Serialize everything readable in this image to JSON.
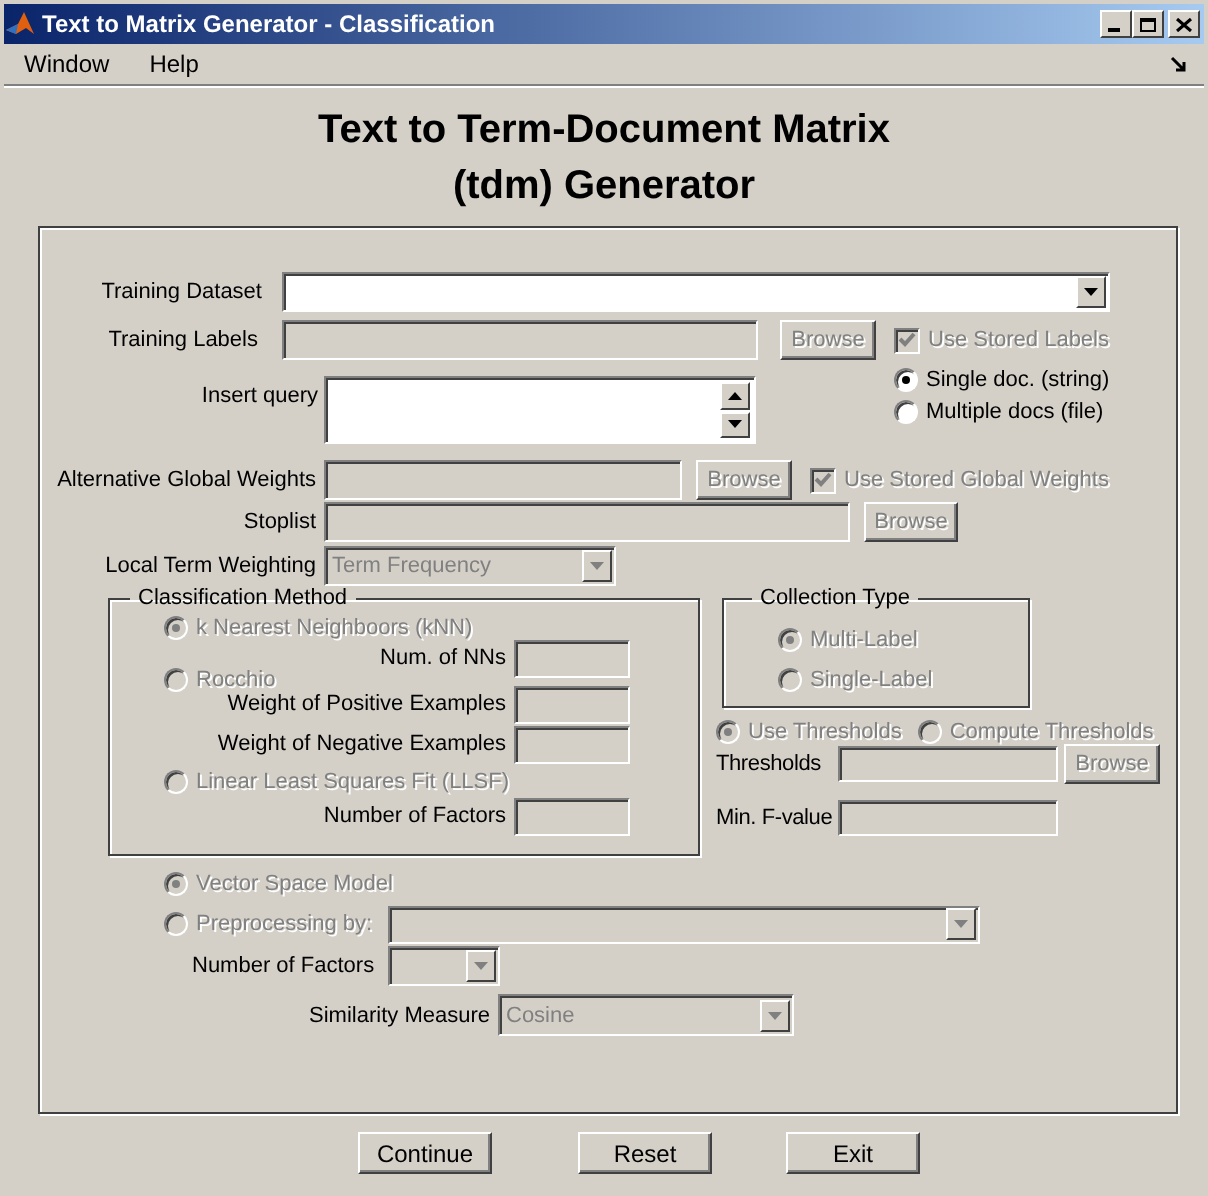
{
  "window": {
    "title": "Text to Matrix Generator - Classification"
  },
  "menu": [
    {
      "label": "Window"
    },
    {
      "label": "Help"
    }
  ],
  "heading": "Text to Term-Document Matrix (tdm) Generator",
  "training_dataset": {
    "label": "Training Dataset",
    "disabled": false
  },
  "training_labels": {
    "label": "Training Labels",
    "disabled": true,
    "browse": {
      "label": "Browse",
      "disabled": true
    },
    "checkbox": {
      "label": "Use Stored Labels",
      "checked": true,
      "disabled": true
    }
  },
  "query": {
    "label": "Insert query",
    "disabled": false,
    "options": [
      {
        "label": "Single doc. (string)",
        "selected": true,
        "disabled": false
      },
      {
        "label": "Multiple docs (file)",
        "selected": false,
        "disabled": false
      }
    ]
  },
  "global_weights": {
    "label": "Alternative Global Weights",
    "disabled": true,
    "browse": {
      "label": "Browse",
      "disabled": true
    },
    "checkbox": {
      "label": "Use Stored Global Weights",
      "checked": true,
      "disabled": true
    }
  },
  "stoplist": {
    "label": "Stoplist",
    "disabled": true,
    "browse": {
      "label": "Browse",
      "disabled": true
    }
  },
  "local_term_weighting": {
    "label": "Local Term Weighting",
    "value": "Term Frequency",
    "disabled": true
  },
  "classification_method": {
    "title": "Classification Method",
    "methods": [
      {
        "label": "k Nearest Neighboors (kNN)",
        "selected": true,
        "disabled": true,
        "params": [
          {
            "label": "Num. of NNs",
            "disabled": true
          }
        ]
      },
      {
        "label": "Rocchio",
        "selected": false,
        "disabled": true,
        "params": [
          {
            "label": "Weight of Positive Examples",
            "disabled": true
          },
          {
            "label": "Weight of Negative Examples",
            "disabled": true
          }
        ]
      },
      {
        "label": "Linear Least Squares Fit (LLSF)",
        "selected": false,
        "disabled": true,
        "params": [
          {
            "label": "Number of Factors",
            "disabled": true
          }
        ]
      }
    ]
  },
  "collection_type": {
    "title": "Collection Type",
    "options": [
      {
        "label": "Multi-Label",
        "selected": true,
        "disabled": true
      },
      {
        "label": "Single-Label",
        "selected": false,
        "disabled": true
      }
    ]
  },
  "thresholds": {
    "options": [
      {
        "label": "Use Thresholds",
        "selected": true,
        "disabled": true
      },
      {
        "label": "Compute Thresholds",
        "selected": false,
        "disabled": true
      }
    ],
    "fields": [
      {
        "label": "Thresholds",
        "disabled": true,
        "browse": {
          "label": "Browse",
          "disabled": true
        }
      },
      {
        "label": "Min. F-value",
        "disabled": true
      }
    ]
  },
  "model": {
    "options": [
      {
        "label": "Vector Space Model",
        "selected": true,
        "disabled": true
      },
      {
        "label": "Preprocessing by:",
        "selected": false,
        "disabled": true
      }
    ],
    "preprocessing": {
      "disabled": true
    },
    "factors": {
      "label": "Number of Factors",
      "disabled": true
    },
    "similarity": {
      "label": "Similarity Measure",
      "value": "Cosine",
      "disabled": true
    }
  },
  "buttons": [
    {
      "label": "Continue",
      "disabled": false
    },
    {
      "label": "Reset",
      "disabled": false
    },
    {
      "label": "Exit",
      "disabled": false
    }
  ]
}
